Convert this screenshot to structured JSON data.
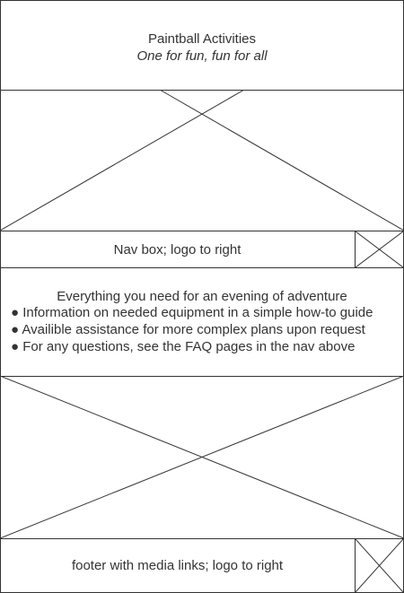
{
  "header": {
    "title": "Paintball Activities",
    "tagline": "One for fun, fun for all"
  },
  "nav": {
    "label": "Nav box; logo to right"
  },
  "intro": {
    "heading": "Everything you need for an evening of adventure",
    "bullets": [
      "● Information on needed equipment in a simple how-to guide",
      "● Availible assistance for more complex plans upon request",
      "● For any questions, see the FAQ pages in the nav above"
    ]
  },
  "footer": {
    "label": "footer with media links; logo to right"
  }
}
